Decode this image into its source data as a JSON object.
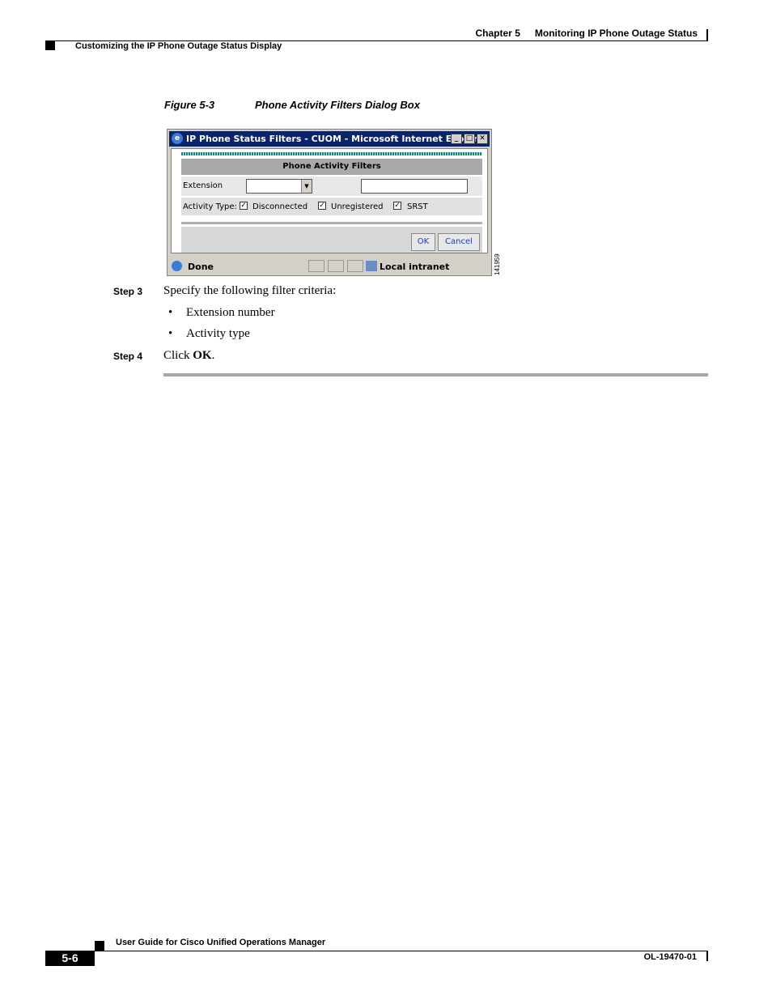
{
  "header": {
    "chapter": "Chapter 5",
    "chapter_title": "Monitoring IP Phone Outage Status",
    "section": "Customizing the IP Phone Outage Status Display"
  },
  "figure": {
    "number": "Figure 5-3",
    "title": "Phone Activity Filters Dialog Box",
    "id": "141959"
  },
  "dialog": {
    "window_title": "IP Phone Status Filters - CUOM - Microsoft Internet Explor...",
    "panel_title": "Phone Activity Filters",
    "extension_label": "Extension",
    "activity_type_label": "Activity Type:",
    "checkboxes": [
      {
        "label": "Disconnected",
        "checked": true
      },
      {
        "label": "Unregistered",
        "checked": true
      },
      {
        "label": "SRST",
        "checked": true
      }
    ],
    "ok_label": "OK",
    "cancel_label": "Cancel",
    "status_done": "Done",
    "status_zone": "Local intranet"
  },
  "steps": [
    {
      "label": "Step 3",
      "text": "Specify the following filter criteria:"
    },
    {
      "label": "Step 4",
      "text_prefix": "Click ",
      "text_bold": "OK",
      "text_suffix": "."
    }
  ],
  "bullets": [
    "Extension number",
    "Activity type"
  ],
  "footer": {
    "guide_title": "User Guide for Cisco Unified Operations Manager",
    "page": "5-6",
    "doc_number": "OL-19470-01"
  }
}
